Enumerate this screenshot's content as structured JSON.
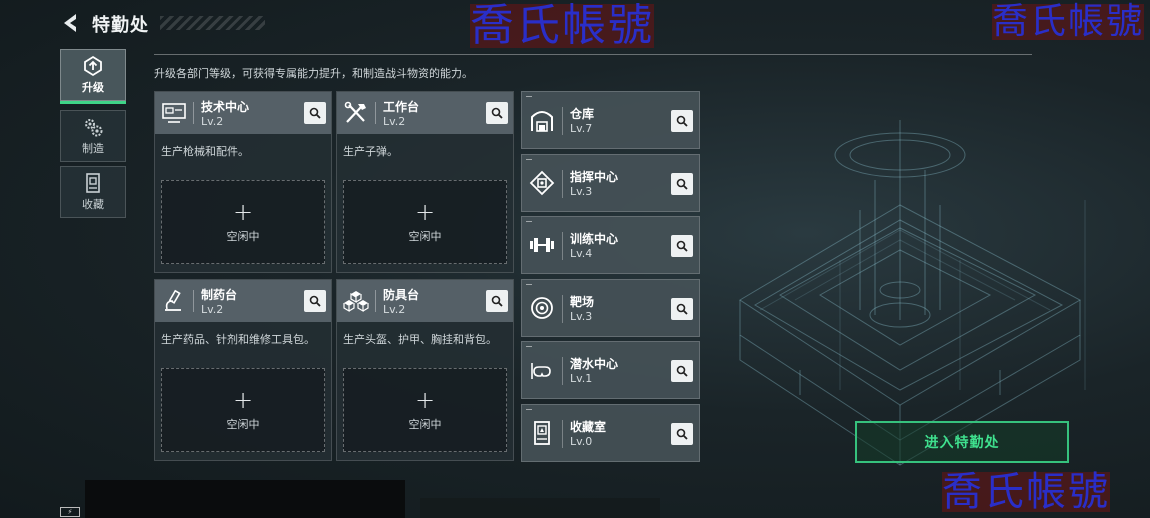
{
  "header": {
    "title": "特勤处",
    "description": "升级各部门等级，可获得专属能力提升，和制造战斗物资的能力。"
  },
  "nav": [
    {
      "label": "升级",
      "icon": "upgrade-icon",
      "active": true
    },
    {
      "label": "制造",
      "icon": "gears-icon",
      "active": false
    },
    {
      "label": "收藏",
      "icon": "collection-icon",
      "active": false
    }
  ],
  "workshops": [
    {
      "name": "技术中心",
      "level": "Lv.2",
      "description": "生产枪械和配件。",
      "slot": "空闲中",
      "icon": "monitor-icon"
    },
    {
      "name": "工作台",
      "level": "Lv.2",
      "description": "生产子弹。",
      "slot": "空闲中",
      "icon": "tools-icon"
    },
    {
      "name": "制药台",
      "level": "Lv.2",
      "description": "生产药品、针剂和维修工具包。",
      "slot": "空闲中",
      "icon": "microscope-icon"
    },
    {
      "name": "防具台",
      "level": "Lv.2",
      "description": "生产头盔、护甲、胸挂和背包。",
      "slot": "空闲中",
      "icon": "cubes-icon"
    }
  ],
  "facilities": [
    {
      "name": "仓库",
      "level": "Lv.7",
      "icon": "warehouse-icon"
    },
    {
      "name": "指挥中心",
      "level": "Lv.3",
      "icon": "chip-icon"
    },
    {
      "name": "训练中心",
      "level": "Lv.4",
      "icon": "dumbbell-icon"
    },
    {
      "name": "靶场",
      "level": "Lv.3",
      "icon": "target-icon"
    },
    {
      "name": "潜水中心",
      "level": "Lv.1",
      "icon": "diving-mask-icon"
    },
    {
      "name": "收藏室",
      "level": "Lv.0",
      "icon": "display-case-icon"
    }
  ],
  "enter_button": "进入特勤处",
  "watermark": "喬氏帳號",
  "colors": {
    "accent": "#3fd488",
    "enter_text": "#3fe08e",
    "watermark": "#2a2ec8"
  }
}
